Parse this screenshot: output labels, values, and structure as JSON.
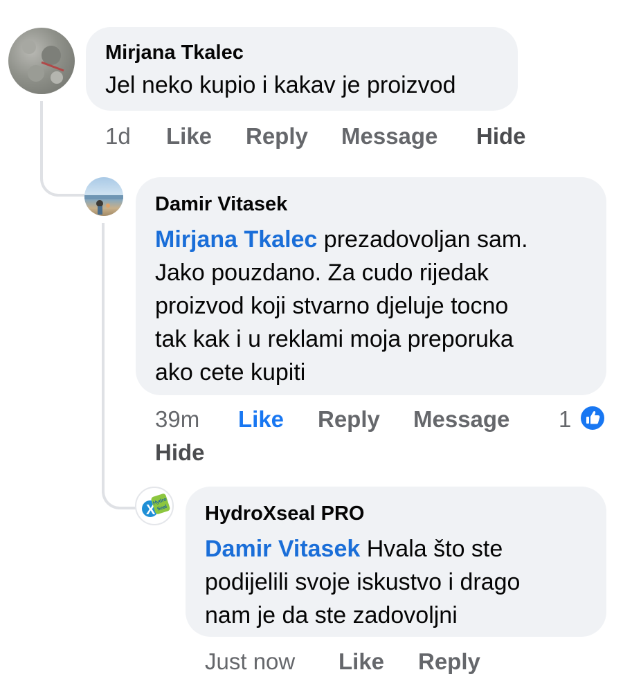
{
  "comments": [
    {
      "author": "Mirjana Tkalec",
      "avatar": "grey-pebble-photo-avatar",
      "mention": "",
      "text": "Jel neko kupio i kakav je proizvod",
      "time": "1d",
      "actions": {
        "like": "Like",
        "reply": "Reply",
        "message": "Message",
        "hide": "Hide"
      }
    },
    {
      "author": "Damir Vitasek",
      "avatar": "beach-photo-avatar",
      "mention": "Mirjana Tkalec",
      "lines": [
        "prezadovoljan sam.",
        "Jako pouzdano. Za cudo rijedak",
        "proizvod koji stvarno djeluje tocno",
        "tak kak i u reklami moja preporuka",
        "ako cete kupiti"
      ],
      "time": "39m",
      "liked": true,
      "reaction_count": "1",
      "actions": {
        "like": "Like",
        "reply": "Reply",
        "message": "Message",
        "hide": "Hide"
      }
    },
    {
      "author": "HydroXseal PRO",
      "avatar": "hydroxseal-logo-avatar",
      "logo_text": "Hydro Seal",
      "mention": "Damir Vitasek",
      "lines": [
        "Hvala što ste",
        "podijelili svoje iskustvo i drago",
        "nam je da ste zadovoljni"
      ],
      "time": "Just now",
      "actions": {
        "like": "Like",
        "reply": "Reply"
      }
    }
  ],
  "colors": {
    "bubble": "#f0f2f5",
    "mention": "#1a6ed8",
    "liked": "#1877f2",
    "meta": "#65676b",
    "thread_line": "#dfe1e5"
  }
}
